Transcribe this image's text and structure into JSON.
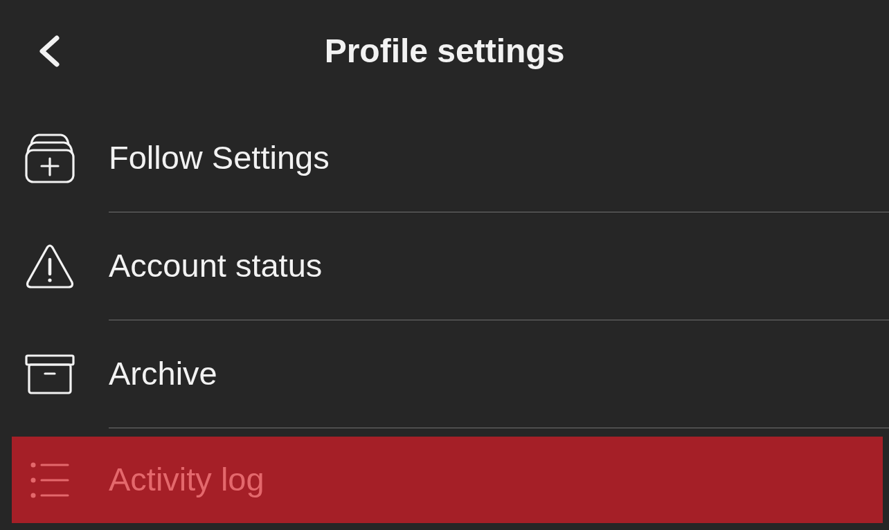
{
  "header": {
    "title": "Profile settings"
  },
  "menu_items": [
    {
      "label": "Follow Settings",
      "selected": false
    },
    {
      "label": "Account status",
      "selected": false
    },
    {
      "label": "Archive",
      "selected": false
    },
    {
      "label": "Activity log",
      "selected": true
    }
  ]
}
